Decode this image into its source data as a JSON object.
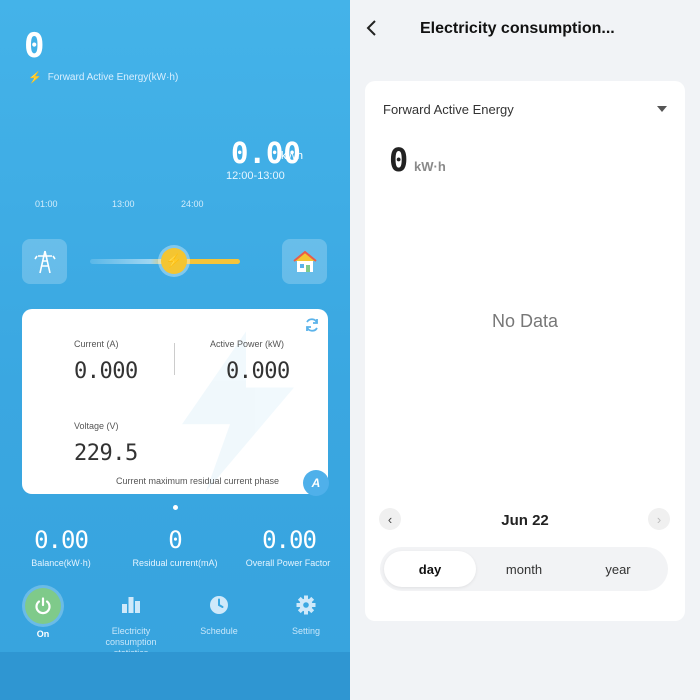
{
  "device": {
    "forward_energy_value": "0",
    "forward_energy_label": "Forward Active Energy(kW·h)",
    "period_value": "0.00",
    "period_unit": "kWh",
    "period_range": "12:00-13:00",
    "ticks": [
      "01:00",
      "13:00",
      "24:00"
    ]
  },
  "readings": {
    "current_label": "Current (A)",
    "current_value": "0.000",
    "power_label": "Active Power (kW)",
    "power_value": "0.000",
    "voltage_label": "Voltage (V)",
    "voltage_value": "229.5",
    "phase_text": "Current maximum residual current phase",
    "phase_badge": "A"
  },
  "stats": [
    {
      "value": "0.00",
      "label": "Balance(kW·h)"
    },
    {
      "value": "0",
      "label": "Residual current(mA)"
    },
    {
      "value": "0.00",
      "label": "Overall Power Factor"
    }
  ],
  "nav": [
    {
      "label": "On",
      "icon": "power-icon",
      "active": true
    },
    {
      "label": "Electricity consumption statistics",
      "icon": "bar-chart-icon"
    },
    {
      "label": "Schedule",
      "icon": "clock-icon"
    },
    {
      "label": "Setting",
      "icon": "gear-icon"
    }
  ],
  "detail": {
    "title": "Electricity consumption...",
    "metric_selected": "Forward Active Energy",
    "energy_value": "0",
    "energy_unit": "kW·h",
    "empty_text": "No Data",
    "date_label": "Jun 22",
    "prev_glyph": "‹",
    "next_glyph": "›",
    "ranges": [
      "day",
      "month",
      "year"
    ],
    "active_range": "day"
  },
  "colors": {
    "primary_blue": "#3ba8e2",
    "accent_yellow": "#f4c531",
    "on_green": "#7fca8a"
  }
}
